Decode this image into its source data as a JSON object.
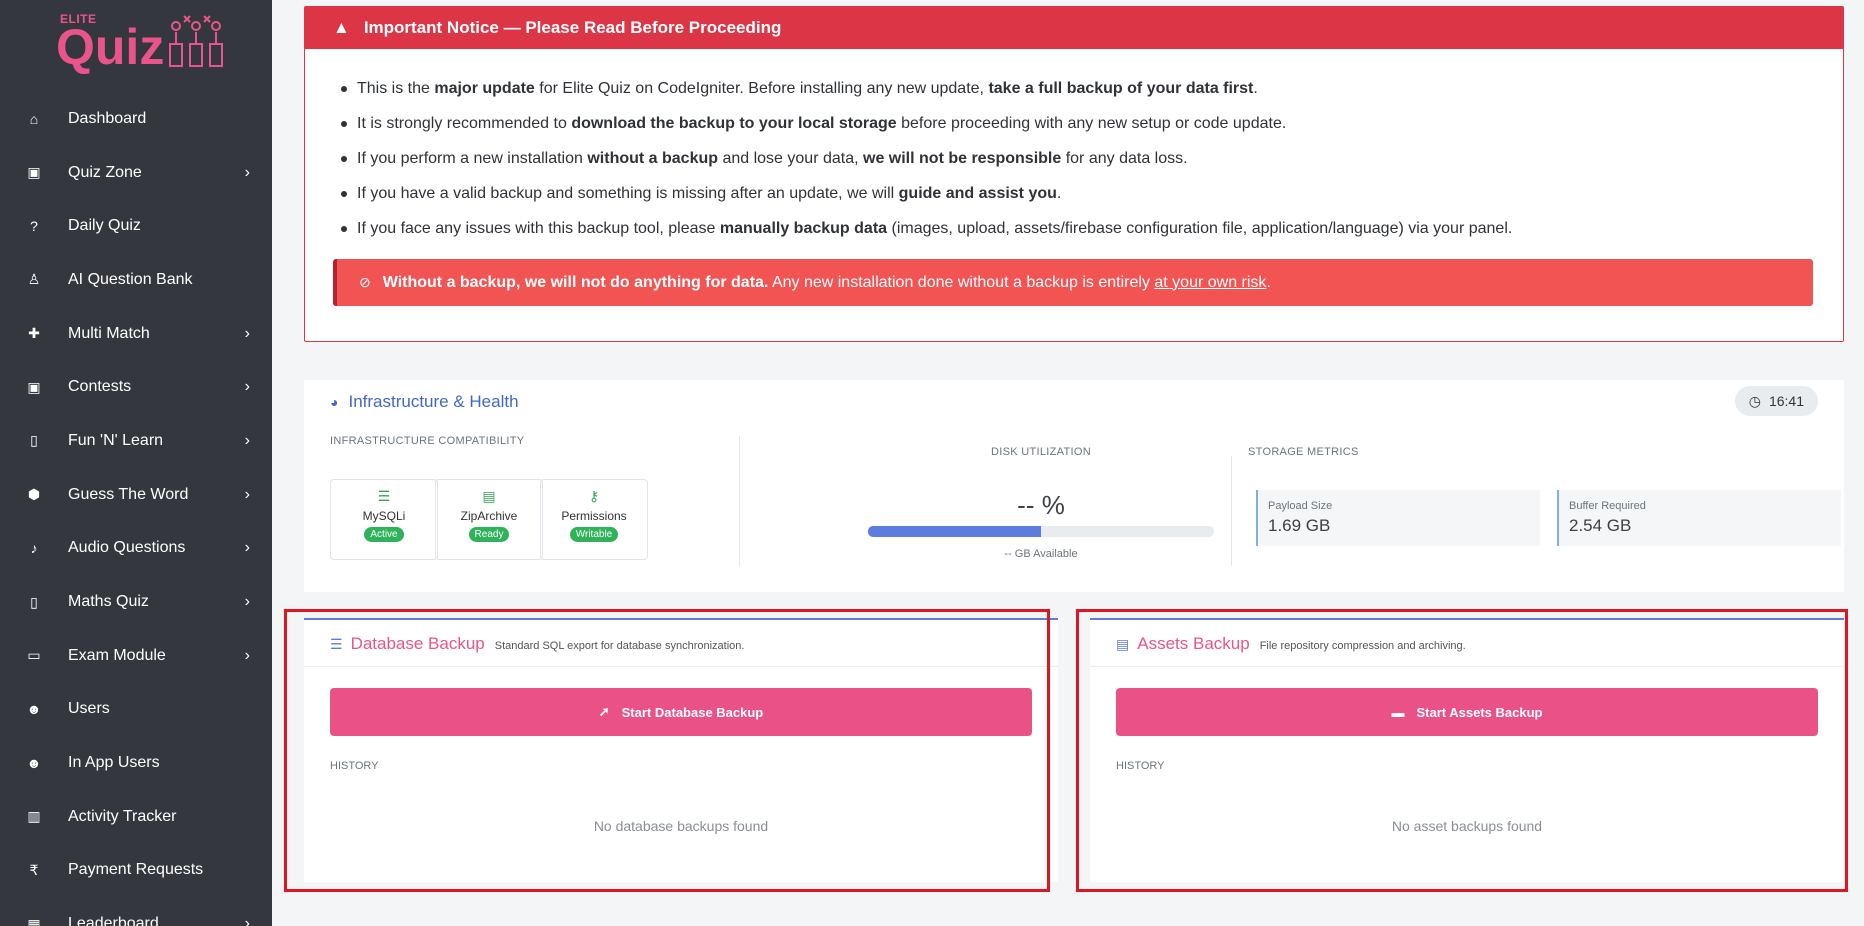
{
  "logo": {
    "small": "ELITE",
    "main": "Quiz"
  },
  "sidebar": {
    "items": [
      {
        "label": "Dashboard",
        "icon": "home-icon",
        "chevron": false
      },
      {
        "label": "Quiz Zone",
        "icon": "gift-icon",
        "chevron": true
      },
      {
        "label": "Daily Quiz",
        "icon": "question-icon",
        "chevron": false
      },
      {
        "label": "AI Question Bank",
        "icon": "robot-icon",
        "chevron": false
      },
      {
        "label": "Multi Match",
        "icon": "puzzle-icon",
        "chevron": true
      },
      {
        "label": "Contests",
        "icon": "gift-icon",
        "chevron": true
      },
      {
        "label": "Fun 'N' Learn",
        "icon": "book-icon",
        "chevron": true
      },
      {
        "label": "Guess The Word",
        "icon": "cube-icon",
        "chevron": true
      },
      {
        "label": "Audio Questions",
        "icon": "microphone-icon",
        "chevron": true
      },
      {
        "label": "Maths Quiz",
        "icon": "book-icon",
        "chevron": true
      },
      {
        "label": "Exam Module",
        "icon": "clipboard-icon",
        "chevron": true
      },
      {
        "label": "Users",
        "icon": "users-icon",
        "chevron": false
      },
      {
        "label": "In App Users",
        "icon": "users-icon",
        "chevron": false
      },
      {
        "label": "Activity Tracker",
        "icon": "chart-icon",
        "chevron": false
      },
      {
        "label": "Payment Requests",
        "icon": "rupee-icon",
        "chevron": false
      },
      {
        "label": "Leaderboard",
        "icon": "grid-icon",
        "chevron": true
      }
    ]
  },
  "notice": {
    "title": "Important Notice — Please Read Before Proceeding",
    "items": [
      [
        {
          "t": "This is the ",
          "b": false
        },
        {
          "t": "major update",
          "b": true
        },
        {
          "t": " for Elite Quiz on CodeIgniter. Before installing any new update, ",
          "b": false
        },
        {
          "t": "take a full backup of your data first",
          "b": true
        },
        {
          "t": ".",
          "b": false
        }
      ],
      [
        {
          "t": "It is strongly recommended to ",
          "b": false
        },
        {
          "t": "download the backup to your local storage",
          "b": true
        },
        {
          "t": " before proceeding with any new setup or code update.",
          "b": false
        }
      ],
      [
        {
          "t": "If you perform a new installation ",
          "b": false
        },
        {
          "t": "without a backup",
          "b": true
        },
        {
          "t": " and lose your data, ",
          "b": false
        },
        {
          "t": "we will not be responsible",
          "b": true
        },
        {
          "t": " for any data loss.",
          "b": false
        }
      ],
      [
        {
          "t": "If you have a valid backup and something is missing after an update, we will ",
          "b": false
        },
        {
          "t": "guide and assist you",
          "b": true
        },
        {
          "t": ".",
          "b": false
        }
      ],
      [
        {
          "t": "If you face any issues with this backup tool, please ",
          "b": false
        },
        {
          "t": "manually backup data",
          "b": true
        },
        {
          "t": " (images, upload, assets/firebase configuration file, application/language) via your panel.",
          "b": false
        }
      ]
    ],
    "alert": {
      "bold": "Without a backup, we will not do anything for data.",
      "text": " Any new installation done without a backup is entirely ",
      "link": "at your own risk",
      "end": "."
    }
  },
  "infra": {
    "title": "Infrastructure & Health",
    "time": "16:41",
    "compat_label": "INFRASTRUCTURE COMPATIBILITY",
    "compat": [
      {
        "name": "MySQLi",
        "badge": "Active",
        "icon": "database-icon"
      },
      {
        "name": "ZipArchive",
        "badge": "Ready",
        "icon": "file-zip-icon"
      },
      {
        "name": "Permissions",
        "badge": "Writable",
        "icon": "key-icon"
      }
    ],
    "disk_label": "DISK UTILIZATION",
    "disk_value": "-- %",
    "disk_fill_fraction": 0.5,
    "disk_available": "-- GB Available",
    "storage_label": "STORAGE METRICS",
    "metrics": [
      {
        "label": "Payload Size",
        "value": "1.69 GB"
      },
      {
        "label": "Buffer Required",
        "value": "2.54 GB"
      }
    ]
  },
  "db_card": {
    "title": "Database Backup",
    "subtitle": "Standard SQL export for database synchronization.",
    "button": "Start Database Backup",
    "history": "HISTORY",
    "empty": "No database backups found"
  },
  "assets_card": {
    "title": "Assets Backup",
    "subtitle": "File repository compression and archiving.",
    "button": "Start Assets Backup",
    "history": "HISTORY",
    "empty": "No asset backups found"
  },
  "colors": {
    "sidebar": "#34373d",
    "accent": "#ea5287",
    "notice": "#dc3545",
    "alert": "#f25454",
    "link": "#4466c7",
    "badge": "#2fb35a"
  }
}
